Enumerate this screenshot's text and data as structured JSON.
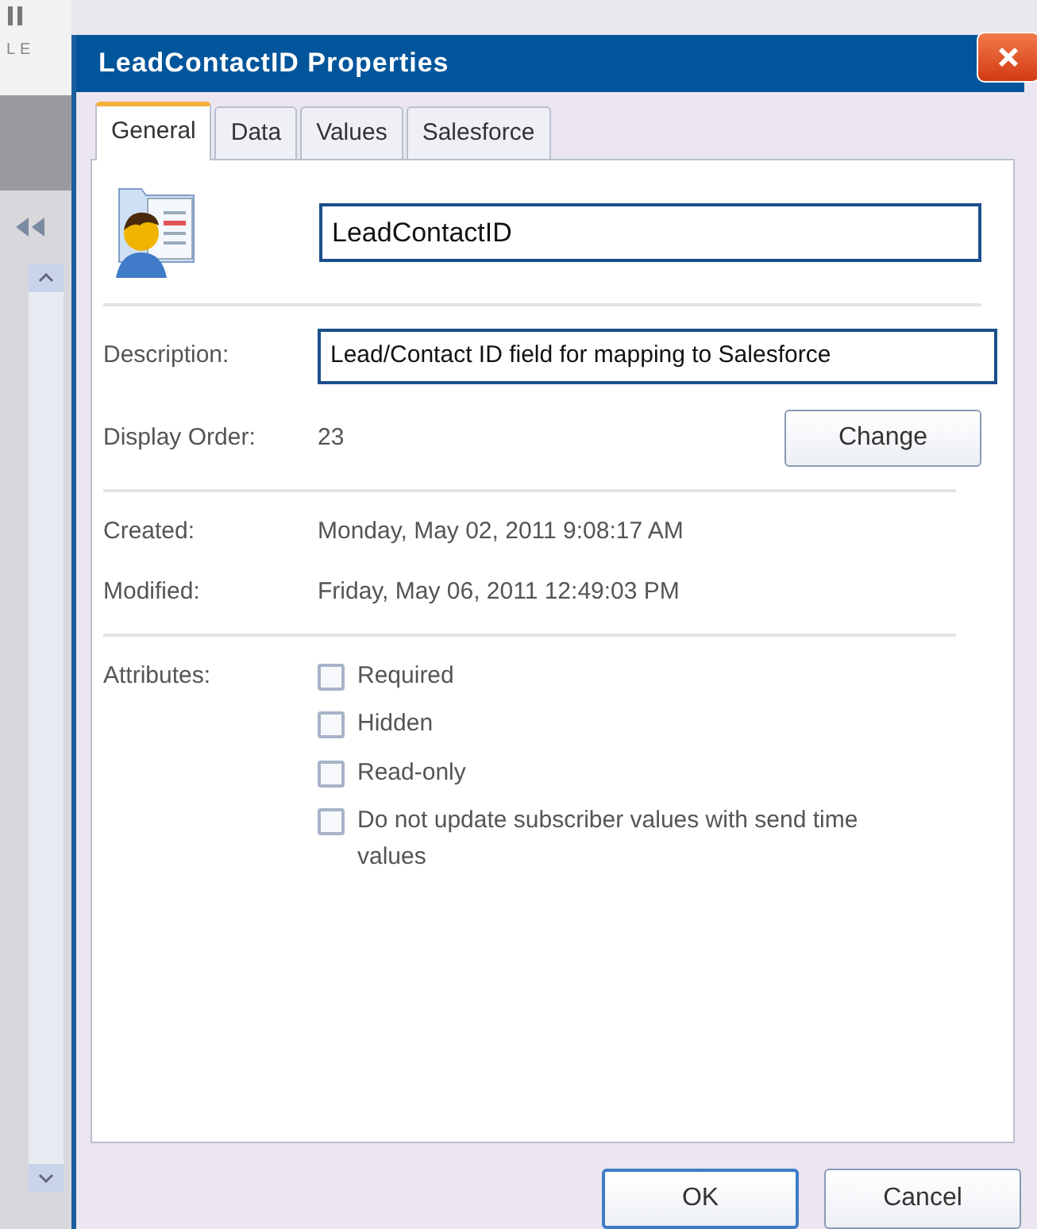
{
  "background_app": {
    "label": "LE"
  },
  "window": {
    "title": "LeadContactID Properties"
  },
  "tabs": [
    {
      "label": "General",
      "selected": true
    },
    {
      "label": "Data",
      "selected": false
    },
    {
      "label": "Values",
      "selected": false
    },
    {
      "label": "Salesforce",
      "selected": false
    }
  ],
  "general": {
    "name_field": {
      "value": "LeadContactID"
    },
    "description": {
      "label": "Description:",
      "value": "Lead/Contact ID field for mapping to Salesforce"
    },
    "display_order": {
      "label": "Display Order:",
      "value": "23",
      "button": "Change"
    },
    "info": [
      {
        "label": "Created:",
        "value": "Monday, May 02, 2011 9:08:17 AM"
      },
      {
        "label": "Modified:",
        "value": "Friday, May 06, 2011 12:49:03 PM"
      }
    ],
    "attributes": {
      "label": "Attributes:",
      "options": [
        {
          "label": "Required",
          "checked": false
        },
        {
          "label": "Hidden",
          "checked": false
        },
        {
          "label": "Read-only",
          "checked": false
        },
        {
          "label": "Do not update subscriber values with send time values",
          "checked": false
        }
      ]
    }
  },
  "buttons": [
    {
      "label": "OK",
      "default": true
    },
    {
      "label": "Cancel",
      "default": false
    }
  ]
}
